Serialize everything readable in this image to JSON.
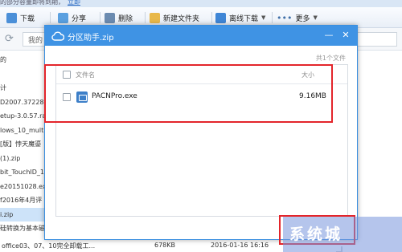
{
  "banner": {
    "text": "的部分容量即将到期，",
    "link": "立即"
  },
  "toolbar": {
    "download": "下载",
    "share": "分享",
    "delete": "删除",
    "new_folder": "新建文件夹",
    "offline_download": "离线下载",
    "more": "更多"
  },
  "address": {
    "text": "我的"
  },
  "background_files": [
    "的",
    "",
    "计",
    "D2007.37228",
    "etup-3.0.57.rar",
    "lows_10_multi",
    "[版】悖天魔鎏",
    "(1).zip",
    "bit_TouchID_1",
    "e20151028.ex",
    "f2016年4月评",
    "i.zip",
    "硅转换为基本磁"
  ],
  "bottom_row": {
    "name": "office03、07、10完全卸载工...",
    "size": "678KB",
    "date": "2016-01-16 16:16"
  },
  "dialog": {
    "title": "分区助手.zip",
    "count": "共1个文件",
    "columns": {
      "name": "文件名",
      "size": "大小"
    },
    "files": [
      {
        "name": "PACNPro.exe",
        "size": "9.16MB"
      }
    ]
  },
  "watermark": {
    "text": "系统城"
  },
  "colors": {
    "title_bar": "#3f93e4",
    "highlight_border": "#e3252b",
    "exe_icon": "#3d7fc8"
  },
  "icons": [
    "download-icon",
    "share-icon",
    "delete-icon",
    "new-folder-icon",
    "offline-download-icon",
    "more-icon",
    "cloud-icon",
    "refresh-icon",
    "exe-icon"
  ]
}
